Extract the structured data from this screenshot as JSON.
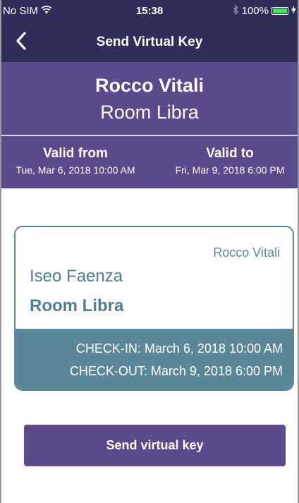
{
  "status_bar": {
    "carrier": "No SIM",
    "time": "15:38",
    "battery": "100%",
    "battery_level": 1.0
  },
  "nav": {
    "title": "Send Virtual Key"
  },
  "guest": {
    "name": "Rocco Vitali",
    "room": "Room Libra"
  },
  "validity": {
    "from_label": "Valid from",
    "from_date": "Tue, Mar 6, 2018 10:00 AM",
    "to_label": "Valid to",
    "to_date": "Fri, Mar 9, 2018 6:00 PM"
  },
  "card": {
    "guest_name": "Rocco Vitali",
    "hotel": "Iseo Faenza",
    "room": "Room Libra",
    "checkin": "CHECK-IN: March 6, 2018 10:00 AM",
    "checkout": "CHECK-OUT: March 9, 2018 6:00 PM"
  },
  "actions": {
    "send_label": "Send virtual key"
  },
  "colors": {
    "nav_bg": "#2f2d59",
    "header_bg": "#5b4a8b",
    "card_accent": "#5b8799",
    "battery_green": "#4cd964"
  }
}
